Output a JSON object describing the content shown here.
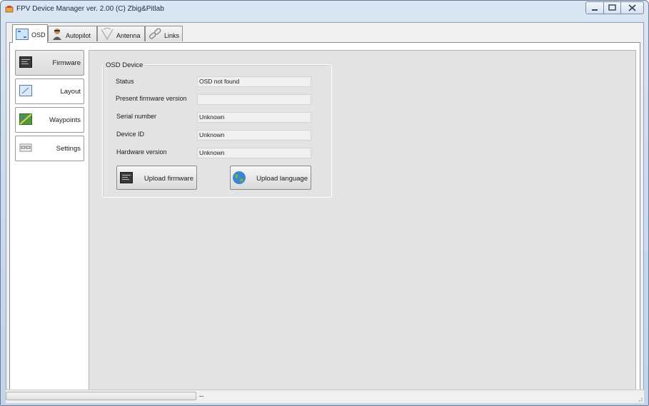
{
  "window": {
    "title": "FPV Device Manager ver. 2.00 (C) Zbig&Pitlab",
    "controls": [
      "minimize",
      "maximize",
      "close"
    ]
  },
  "tabs": [
    {
      "label": "OSD",
      "icon": "osd-icon",
      "active": true
    },
    {
      "label": "Autopilot",
      "icon": "pilot-icon",
      "active": false
    },
    {
      "label": "Antenna",
      "icon": "antenna-icon",
      "active": false
    },
    {
      "label": "Links",
      "icon": "chain-link-icon",
      "active": false
    }
  ],
  "sidebar": {
    "items": [
      {
        "label": "Firmware",
        "icon": "chip-icon",
        "active": true
      },
      {
        "label": "Layout",
        "icon": "layout-icon",
        "active": false
      },
      {
        "label": "Waypoints",
        "icon": "map-icon",
        "active": false
      },
      {
        "label": "Settings",
        "icon": "settings-icon",
        "active": false
      }
    ]
  },
  "osd_device": {
    "group_title": "OSD Device",
    "rows": [
      {
        "label": "Status",
        "value": "OSD not found"
      },
      {
        "label": "Present firmware version",
        "value": ""
      },
      {
        "label": "Serial number",
        "value": "Unknown"
      },
      {
        "label": "Device ID",
        "value": "Unknown"
      },
      {
        "label": "Hardware version",
        "value": "Unknown"
      }
    ],
    "upload_firmware_label": "Upload firmware",
    "upload_language_label": "Upload language"
  },
  "statusbar": {
    "progress": 0,
    "text": "--"
  },
  "colors": {
    "accent": "#3a78c8",
    "panel": "#e3e3e3"
  }
}
